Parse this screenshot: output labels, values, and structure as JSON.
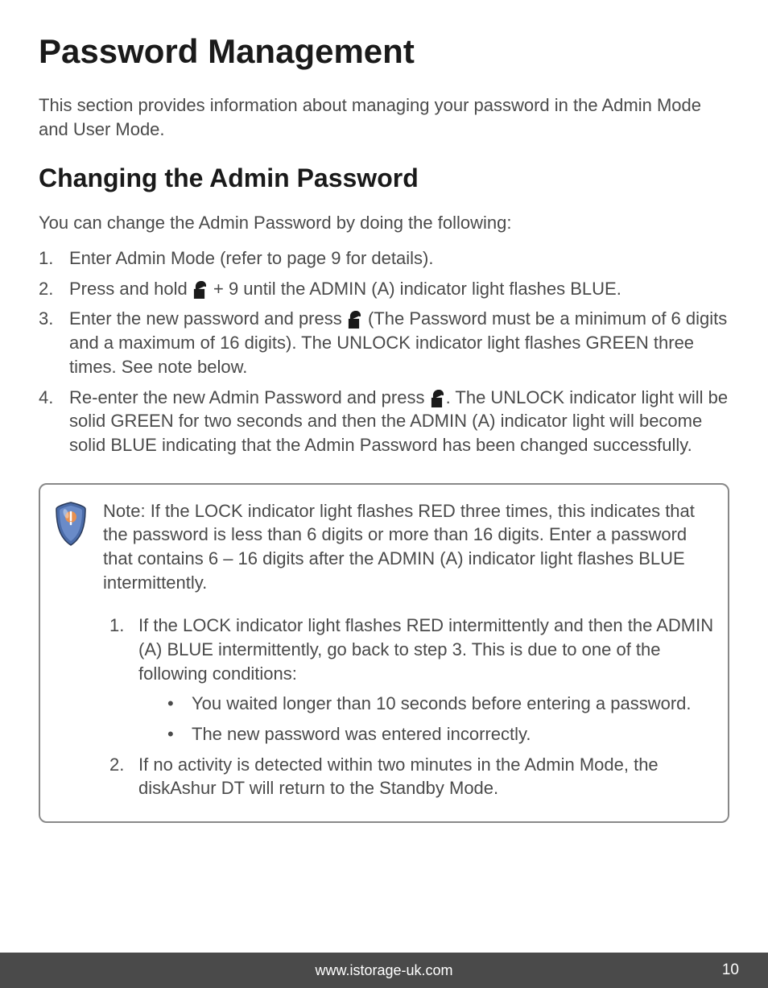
{
  "title": "Password Management",
  "intro": "This section provides information about managing your password in the Admin Mode and User Mode.",
  "section_heading": "Changing the Admin Password",
  "lead": "You can change the Admin Password by doing the following:",
  "steps": {
    "s1": "Enter Admin Mode (refer to page 9 for details).",
    "s2_a": "Press and hold ",
    "s2_b": " + 9 until the ADMIN (A) indicator light flashes BLUE.",
    "s3_a": "Enter the new password and press ",
    "s3_b": " (The Password must be a minimum of 6 digits and a maximum of 16 digits). The UNLOCK indicator light flashes GREEN three times. See note below.",
    "s4_a": "Re-enter the new Admin Password and press ",
    "s4_b": ". The UNLOCK indicator light will be solid GREEN for two seconds and then the ADMIN (A) indicator light will become solid BLUE indicating that the Admin Password has been changed successfully."
  },
  "note": {
    "text": "Note: If the LOCK indicator light flashes RED three times, this indicates that the password is less than 6 digits or more than 16 digits. Enter a password that contains 6 – 16 digits after the ADMIN (A) indicator light flashes BLUE intermittently.",
    "item1": "If the LOCK indicator light flashes RED intermittently and then the ADMIN (A) BLUE intermittently, go back to step 3. This is due to one of the following conditions:",
    "bullet1": "You waited longer than 10 seconds before entering a password.",
    "bullet2": "The new password was entered incorrectly.",
    "item2": "If no activity is detected within two minutes in the Admin Mode, the diskAshur DT will return to the Standby Mode."
  },
  "footer": {
    "url": "www.istorage-uk.com",
    "page": "10"
  }
}
